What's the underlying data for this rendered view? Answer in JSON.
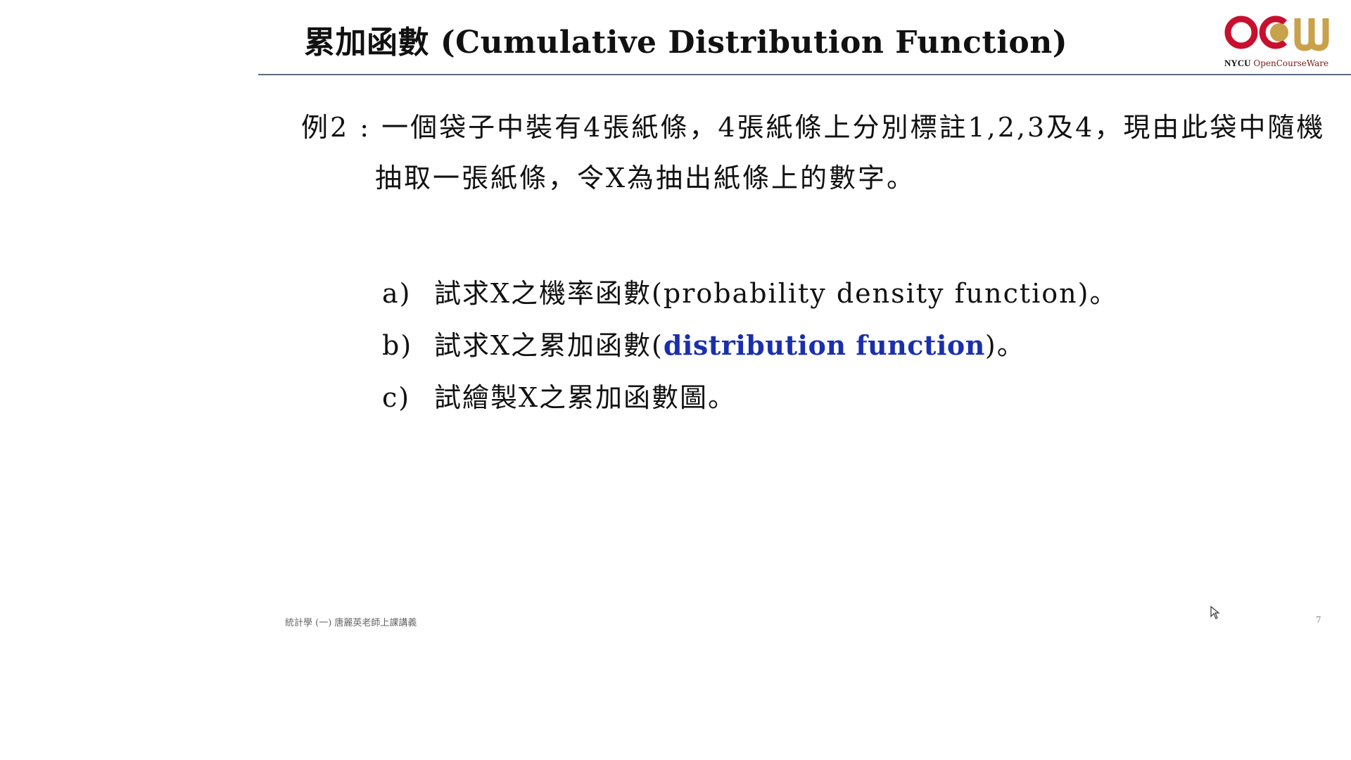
{
  "slide": {
    "title": "累加函數 (Cumulative Distribution Function)",
    "logo": {
      "brand": "OCW",
      "caption_bold": "NYCU",
      "caption": " OpenCourseWare",
      "colors": {
        "red": "#c8102e",
        "gold": "#c9a14a"
      }
    },
    "problem": {
      "line1": "例2 : 一個袋子中裝有4張紙條，4張紙條上分別標註1,2,3及4，現由此袋中隨機",
      "line2": "抽取一張紙條，令X為抽出紙條上的數字。"
    },
    "items": [
      {
        "label": "a)",
        "pre": "試求X之機率函數(probability density function)。",
        "emph": "",
        "post": ""
      },
      {
        "label": "b)",
        "pre": "試求X之累加函數(",
        "emph": "distribution function",
        "post": ")。"
      },
      {
        "label": "c)",
        "pre": "試繪製X之累加函數圖。",
        "emph": "",
        "post": ""
      }
    ],
    "footer": {
      "course": "統計學 (一) 唐麗英老師上課講義",
      "page_number": "7"
    },
    "colors": {
      "emphasis": "#1a2fae",
      "rule": "#5a6c80"
    }
  }
}
